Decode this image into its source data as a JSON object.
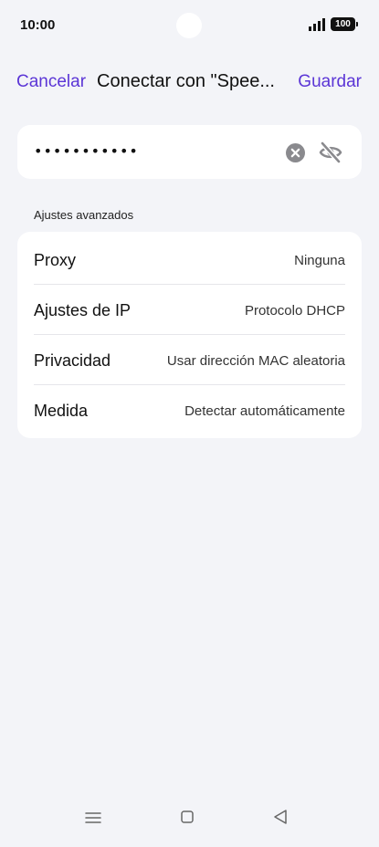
{
  "status_bar": {
    "time": "10:00",
    "battery": "100",
    "signal_icon": "signal-bars-icon"
  },
  "header": {
    "cancel_label": "Cancelar",
    "title": "Conectar con \"Spee...",
    "save_label": "Guardar"
  },
  "password": {
    "value": "•••••••••••",
    "clear_icon": "clear-circle-icon",
    "visibility_icon": "eye-off-icon"
  },
  "advanced": {
    "section_label": "Ajustes avanzados",
    "rows": [
      {
        "label": "Proxy",
        "value": "Ninguna"
      },
      {
        "label": "Ajustes de IP",
        "value": "Protocolo DHCP"
      },
      {
        "label": "Privacidad",
        "value": "Usar dirección MAC aleatoria"
      },
      {
        "label": "Medida",
        "value": "Detectar automáticamente"
      }
    ]
  },
  "nav_bar": {
    "icons": [
      "menu-icon",
      "home-icon",
      "back-icon"
    ]
  },
  "colors": {
    "accent": "#5b35d6",
    "background": "#f3f4f8",
    "card": "#ffffff"
  }
}
